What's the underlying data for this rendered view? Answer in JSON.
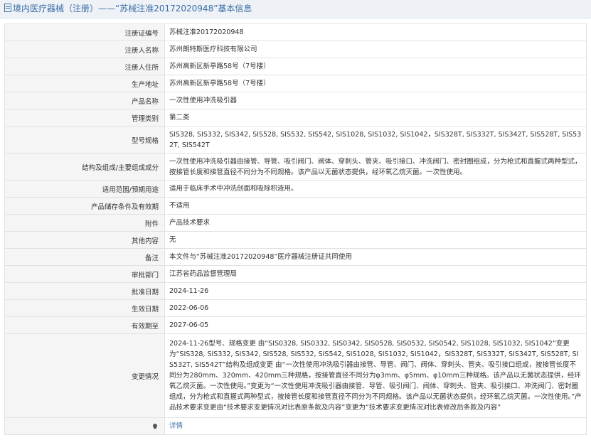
{
  "header": {
    "title": "境内医疗器械（注册）——“苏械注准20172020948”基本信息"
  },
  "rows": [
    {
      "label": "注册证编号",
      "value": "苏械注准20172020948"
    },
    {
      "label": "注册人名称",
      "value": "苏州朗特斯医疗科技有限公司"
    },
    {
      "label": "注册人住所",
      "value": "苏州高新区新亭路58号（7号楼）"
    },
    {
      "label": "生产地址",
      "value": "苏州高新区新亭路58号（7号楼）"
    },
    {
      "label": "产品名称",
      "value": "一次性使用冲洗吸引器"
    },
    {
      "label": "管理类别",
      "value": "第二类"
    },
    {
      "label": "型号规格",
      "value": "SIS328, SIS332, SIS342, SIS528, SIS532, SIS542, SIS1028, SIS1032, SIS1042，SIS328T, SIS332T, SIS342T, SIS528T, SIS532T, SIS542T"
    },
    {
      "label": "结构及组成/主要组成成分",
      "value": "一次性使用冲洗吸引器由接管、导管、吸引阀门、阀体、穿刺头、管夹、吸引接口、冲洗阀门、密封圈组成，分为枪式和直握式两种型式，按接管长度和接管直径不同分为不同规格。该产品以无菌状态提供，经环氧乙烷灭菌。一次性使用。"
    },
    {
      "label": "适用范围/预期用途",
      "value": "适用于临床手术中冲洗创面和吸除积液用。"
    },
    {
      "label": "产品储存条件及有效期",
      "value": "不适用"
    },
    {
      "label": "附件",
      "value": "产品技术要求"
    },
    {
      "label": "其他内容",
      "value": "无"
    },
    {
      "label": "备注",
      "value": "本文件与“苏械注准20172020948”医疗器械注册证共同使用"
    },
    {
      "label": "审批部门",
      "value": "江苏省药品监督管理局"
    },
    {
      "label": "批准日期",
      "value": "2024-11-26"
    },
    {
      "label": "生效日期",
      "value": "2022-06-06"
    },
    {
      "label": "有效期至",
      "value": "2027-06-05"
    },
    {
      "label": "变更情况",
      "value": "2024-11-26型号、规格变更 由“SIS0328, SIS0332, SIS0342, SIS0528, SIS0532, SIS0542, SIS1028, SIS1032, SIS1042”变更为“SIS328, SIS332, SIS342, SIS528, SIS532, SIS542, SIS1028, SIS1032, SIS1042，SIS328T, SIS332T, SIS342T, SIS528T, SIS532T, SIS542T”结构及组成变更 由“一次性使用冲洗吸引器由接管、导管、阀门、阀体、穿刺头、管夹、吸引接口组成，按接管长度不同分为280mm、320mm、420mm三种规格，按接管直径不同分为φ3mm、φ5mm、φ10mm三种规格。该产品以无菌状态提供，经环氧乙烷灭菌。一次性使用。”变更为“一次性使用冲洗吸引器由接管、导管、吸引阀门、阀体、穿刺头、管夹、吸引接口、冲洗阀门、密封圈组成，分为枪式和直握式两种型式，按接管长度和接管直径不同分为不同规格。该产品以无菌状态提供，经环氧乙烷灭菌。一次性使用。”产品技术要求变更由“技术要求变更情况对比表原条款及内容”变更为“技术要求变更情况对比表修改后条款及内容”"
    }
  ],
  "footer_row": {
    "icon": "lightbulb-icon",
    "link": "详情"
  }
}
